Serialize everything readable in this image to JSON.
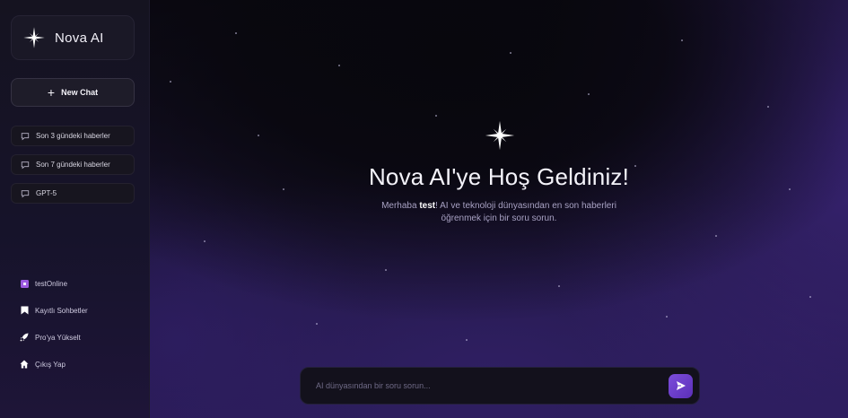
{
  "brand": {
    "name": "Nova AI",
    "logo_icon": "sparkle-star-icon"
  },
  "sidebar": {
    "new_chat_label": "New Chat",
    "history": [
      {
        "label": "Son 3 gündeki haberler",
        "icon": "chat-bubble-icon"
      },
      {
        "label": "Son 7 gündeki haberler",
        "icon": "chat-bubble-icon"
      },
      {
        "label": "GPT-5",
        "icon": "chat-bubble-icon"
      }
    ],
    "nav": [
      {
        "label": "testOnline",
        "icon": "status-square-icon"
      },
      {
        "label": "Kayıtlı Sohbetler",
        "icon": "bookmark-icon"
      },
      {
        "label": "Pro'ya Yükselt",
        "icon": "rocket-icon"
      },
      {
        "label": "Çıkış Yap",
        "icon": "home-icon"
      }
    ]
  },
  "welcome": {
    "title": "Nova AI'ye Hoş Geldiniz!",
    "greeting_prefix": "Merhaba ",
    "username": "test",
    "greeting_suffix": "! AI ve teknoloji dünyasından en son haberleri öğrenmek için bir soru sorun."
  },
  "composer": {
    "placeholder": "AI dünyasından bir soru sorun...",
    "value": ""
  },
  "colors": {
    "accent": "#6b3fcb",
    "sidebar_bg": "#151320",
    "main_bg": "#0c0a14"
  }
}
